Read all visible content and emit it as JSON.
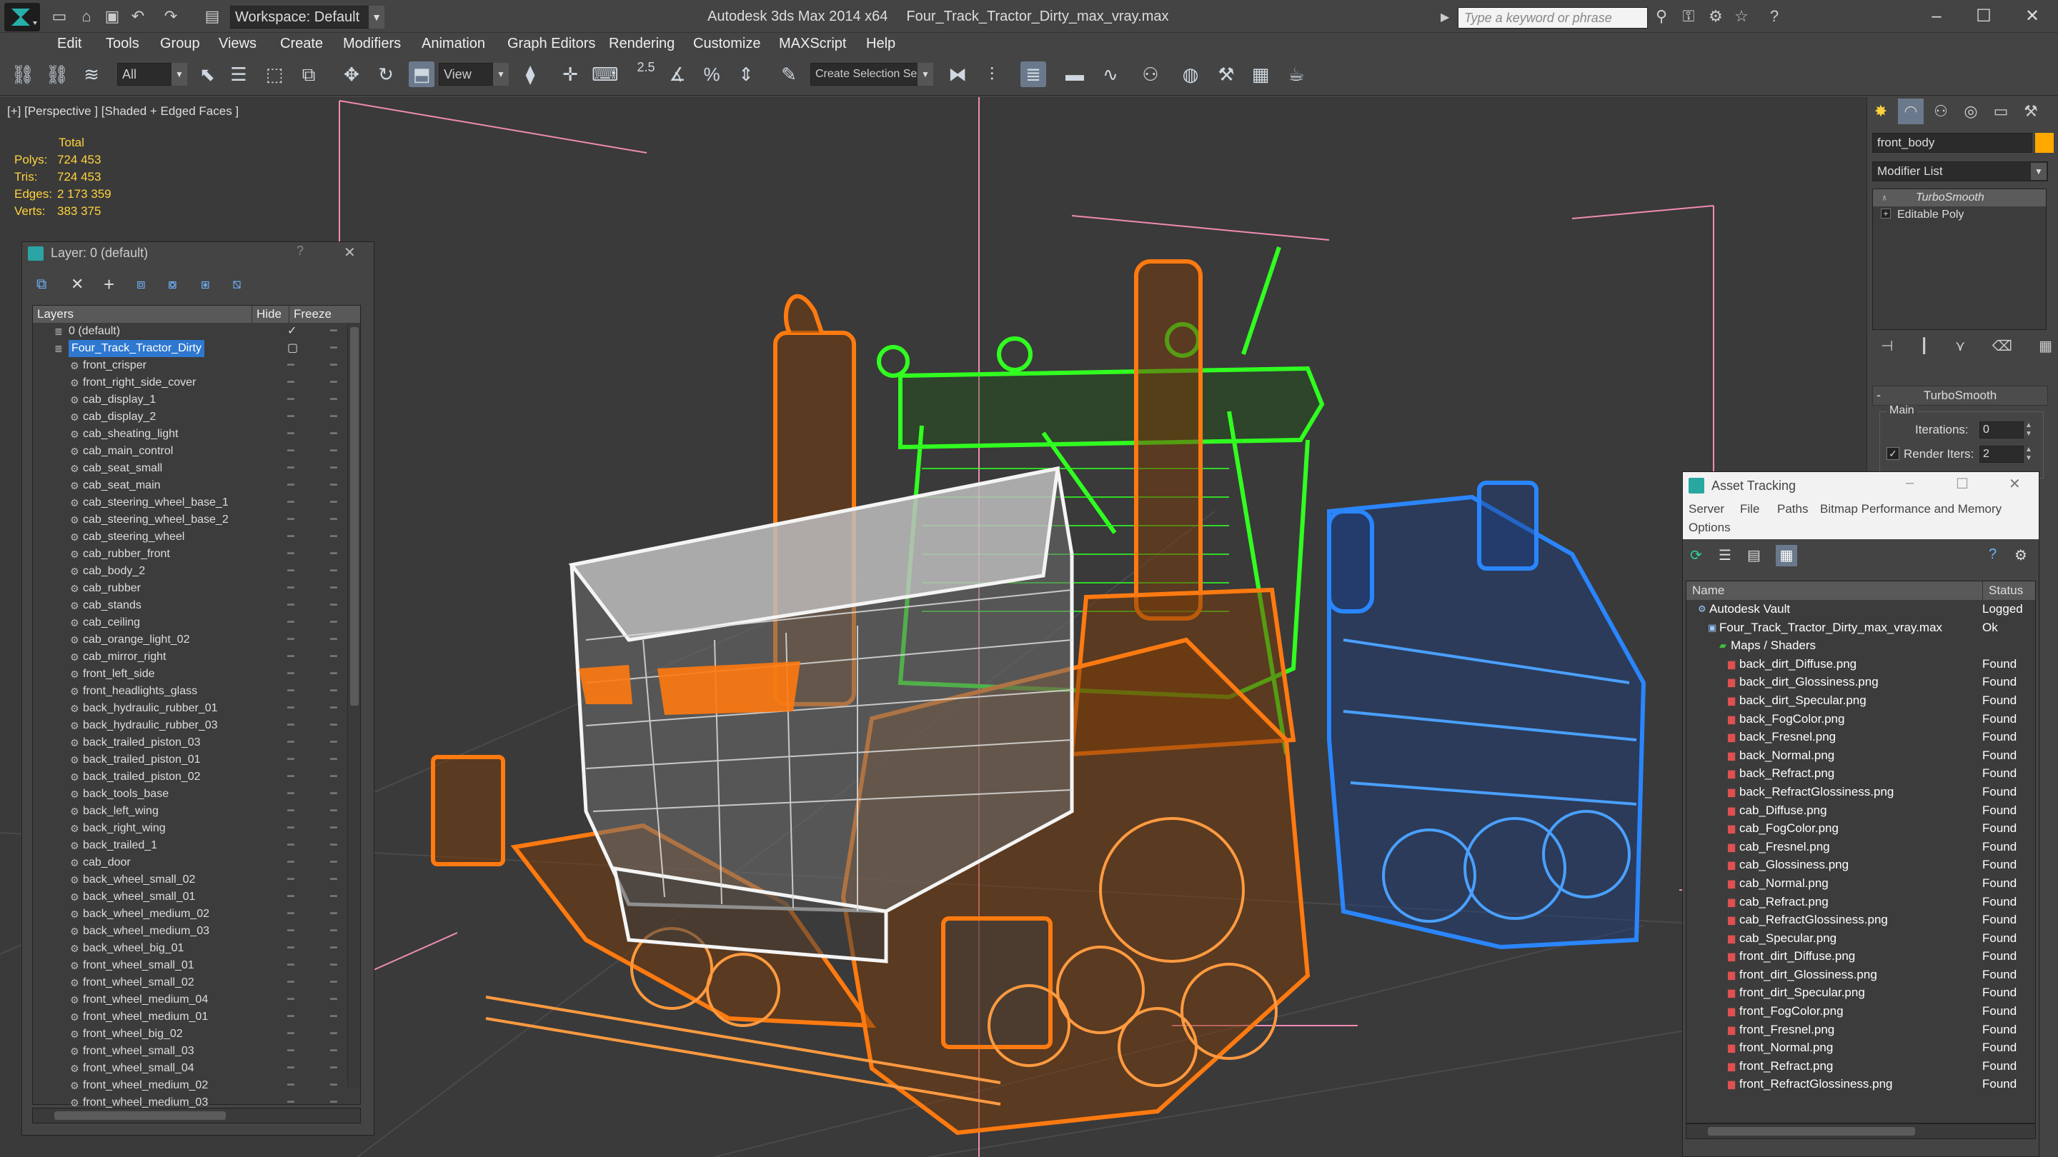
{
  "app": {
    "title": "Autodesk 3ds Max  2014 x64",
    "file": "Four_Track_Tractor_Dirty_max_vray.max",
    "workspace": "Workspace: Default",
    "search_placeholder": "Type a keyword or phrase"
  },
  "menu": [
    "Edit",
    "Tools",
    "Group",
    "Views",
    "Create",
    "Modifiers",
    "Animation",
    "Graph Editors",
    "Rendering",
    "Customize",
    "MAXScript",
    "Help"
  ],
  "toolbar": {
    "filter": "All",
    "refcoord": "View",
    "snap_value": "2.5",
    "selection_set": "Create Selection Se"
  },
  "viewport": {
    "label": "[+] [Perspective ] [Shaded + Edged Faces ]",
    "stats_header": "Total",
    "stats": [
      {
        "k": "Polys:",
        "v": "724 453"
      },
      {
        "k": "Tris:",
        "v": "724 453"
      },
      {
        "k": "Edges:",
        "v": "2 173 359"
      },
      {
        "k": "Verts:",
        "v": "383 375"
      }
    ],
    "colors": {
      "orange": "#ff7a10",
      "green": "#30ff20",
      "blue": "#2a86ff",
      "white": "#f4f4f4"
    }
  },
  "layer_panel": {
    "title": "Layer: 0 (default)",
    "help": "?",
    "close": "✕",
    "col_layers": "Layers",
    "col_hide": "Hide",
    "col_freeze": "Freeze",
    "rows": [
      "0 (default)",
      "Four_Track_Tractor_Dirty",
      "front_crisper",
      "front_right_side_cover",
      "cab_display_1",
      "cab_display_2",
      "cab_sheating_light",
      "cab_main_control",
      "cab_seat_small",
      "cab_seat_main",
      "cab_steering_wheel_base_1",
      "cab_steering_wheel_base_2",
      "cab_steering_wheel",
      "cab_rubber_front",
      "cab_body_2",
      "cab_rubber",
      "cab_stands",
      "cab_ceiling",
      "cab_orange_light_02",
      "cab_mirror_right",
      "front_left_side",
      "front_headlights_glass",
      "back_hydraulic_rubber_01",
      "back_hydraulic_rubber_03",
      "back_trailed_piston_03",
      "back_trailed_piston_01",
      "back_trailed_piston_02",
      "back_tools_base",
      "back_left_wing",
      "back_right_wing",
      "back_trailed_1",
      "cab_door",
      "back_wheel_small_02",
      "back_wheel_small_01",
      "back_wheel_medium_02",
      "back_wheel_medium_03",
      "back_wheel_big_01",
      "front_wheel_small_01",
      "front_wheel_small_02",
      "front_wheel_medium_04",
      "front_wheel_medium_01",
      "front_wheel_big_02",
      "front_wheel_small_03",
      "front_wheel_small_04",
      "front_wheel_medium_02",
      "front_wheel_medium_03"
    ]
  },
  "command_panel": {
    "object_name": "front_body",
    "modifier_list": "Modifier List",
    "stack": [
      "TurboSmooth",
      "Editable Poly"
    ],
    "rollout_title": "TurboSmooth",
    "main_label": "Main",
    "iterations_label": "Iterations:",
    "iterations_value": "0",
    "render_iters_label": "Render Iters:",
    "render_iters_value": "2"
  },
  "asset_tracking": {
    "title": "Asset Tracking",
    "menu": [
      "Server",
      "File",
      "Paths",
      "Bitmap Performance and Memory",
      "Options"
    ],
    "col_name": "Name",
    "col_status": "Status",
    "rows": [
      {
        "name": "Autodesk Vault",
        "status": "Logged",
        "indent": 1
      },
      {
        "name": "Four_Track_Tractor_Dirty_max_vray.max",
        "status": "Ok",
        "indent": 2
      },
      {
        "name": "Maps / Shaders",
        "status": "",
        "indent": 3
      },
      {
        "name": "back_dirt_Diffuse.png",
        "status": "Found",
        "indent": 4
      },
      {
        "name": "back_dirt_Glossiness.png",
        "status": "Found",
        "indent": 4
      },
      {
        "name": "back_dirt_Specular.png",
        "status": "Found",
        "indent": 4
      },
      {
        "name": "back_FogColor.png",
        "status": "Found",
        "indent": 4
      },
      {
        "name": "back_Fresnel.png",
        "status": "Found",
        "indent": 4
      },
      {
        "name": "back_Normal.png",
        "status": "Found",
        "indent": 4
      },
      {
        "name": "back_Refract.png",
        "status": "Found",
        "indent": 4
      },
      {
        "name": "back_RefractGlossiness.png",
        "status": "Found",
        "indent": 4
      },
      {
        "name": "cab_Diffuse.png",
        "status": "Found",
        "indent": 4
      },
      {
        "name": "cab_FogColor.png",
        "status": "Found",
        "indent": 4
      },
      {
        "name": "cab_Fresnel.png",
        "status": "Found",
        "indent": 4
      },
      {
        "name": "cab_Glossiness.png",
        "status": "Found",
        "indent": 4
      },
      {
        "name": "cab_Normal.png",
        "status": "Found",
        "indent": 4
      },
      {
        "name": "cab_Refract.png",
        "status": "Found",
        "indent": 4
      },
      {
        "name": "cab_RefractGlossiness.png",
        "status": "Found",
        "indent": 4
      },
      {
        "name": "cab_Specular.png",
        "status": "Found",
        "indent": 4
      },
      {
        "name": "front_dirt_Diffuse.png",
        "status": "Found",
        "indent": 4
      },
      {
        "name": "front_dirt_Glossiness.png",
        "status": "Found",
        "indent": 4
      },
      {
        "name": "front_dirt_Specular.png",
        "status": "Found",
        "indent": 4
      },
      {
        "name": "front_FogColor.png",
        "status": "Found",
        "indent": 4
      },
      {
        "name": "front_Fresnel.png",
        "status": "Found",
        "indent": 4
      },
      {
        "name": "front_Normal.png",
        "status": "Found",
        "indent": 4
      },
      {
        "name": "front_Refract.png",
        "status": "Found",
        "indent": 4
      },
      {
        "name": "front_RefractGlossiness.png",
        "status": "Found",
        "indent": 4
      }
    ]
  }
}
